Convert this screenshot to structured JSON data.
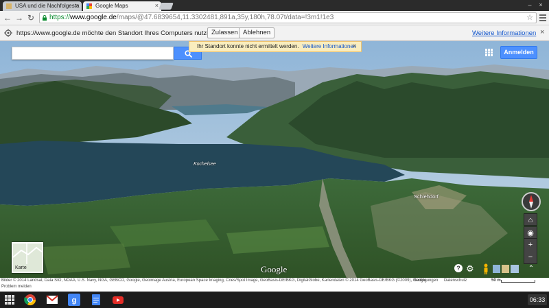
{
  "browser": {
    "tabs": [
      {
        "title": "USA und die Nachfolgesta",
        "active": false
      },
      {
        "title": "Google Maps",
        "active": true
      }
    ],
    "url": {
      "protocol": "https://",
      "host": "www.google.de",
      "path": "/maps/@47.6839654,11.3302481,891a,35y,180h,78.07t/data=!3m1!1e3"
    }
  },
  "infobar": {
    "message": "https://www.google.de möchte den Standort Ihres Computers nutzen.",
    "allow_label": "Zulassen",
    "deny_label": "Ablehnen",
    "more_label": "Weitere Informationen"
  },
  "maps": {
    "search_placeholder": "",
    "toast_message": "Ihr Standort konnte nicht ermittelt werden.",
    "toast_link": "Weitere Informationen",
    "signin_label": "Anmelden",
    "lake_label": "Kochelsee",
    "town_label": "Schlehdorf",
    "minimap_label": "Karte",
    "logo_text": "Google",
    "zoom_in": "+",
    "zoom_out": "−",
    "attribution": "Bilder © 2014 Landsat, Data SIO, NOAA, U.S. Navy, NGA, GEBCO, Google, Geoimage Austria, European Space Imaging, Cnes/Spot Image, GeoBasis-DE/BKG, DigitalGlobe, Kartendaten © 2014 GeoBasis-DE/BKG (©2009), Google",
    "terms_label": "Bedingungen",
    "privacy_label": "Datenschutz",
    "report_label": "Problem melden",
    "scale_label": "50 m"
  },
  "shelf": {
    "apps": [
      "chrome-icon",
      "gmail-icon",
      "google-search-icon",
      "docs-icon",
      "youtube-icon"
    ],
    "clock": "06:33"
  },
  "colors": {
    "accent_blue": "#4d90fe",
    "toast_bg": "#f9edbe",
    "url_green": "#0a8a2e",
    "link_blue": "#1155cc"
  }
}
